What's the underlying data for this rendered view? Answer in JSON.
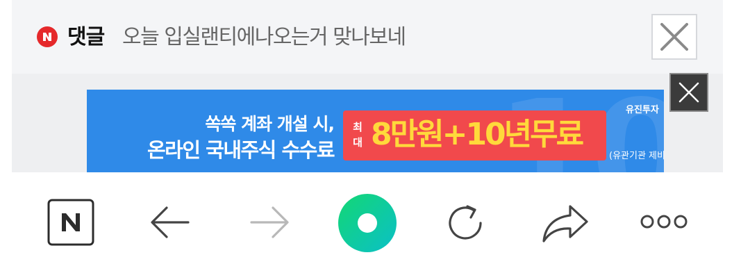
{
  "comment_bar": {
    "badge_letter": "N",
    "label": "댓글",
    "text": "오늘 입실랜티에나오는거 맞나보네",
    "close_icon": "close-icon"
  },
  "ad": {
    "line1": "쏙쏙 계좌 개설 시,",
    "line2": "온라인 국내주식 수수료",
    "prefix_line1": "최",
    "prefix_line2": "대",
    "offer": "8만원+10년무료",
    "brand": "유진투자",
    "disclaimer": "(유관기관 제비",
    "close_icon": "close-icon",
    "colors": {
      "background": "#2f8ae8",
      "promo": "#f1494c",
      "offer_text": "#ffd93b"
    }
  },
  "toolbar": {
    "items": [
      {
        "name": "naver-home",
        "icon": "naver-n-icon"
      },
      {
        "name": "back",
        "icon": "arrow-left-icon"
      },
      {
        "name": "forward",
        "icon": "arrow-right-icon",
        "disabled": true
      },
      {
        "name": "green-dot",
        "icon": "green-circle-icon"
      },
      {
        "name": "reload",
        "icon": "reload-icon"
      },
      {
        "name": "share",
        "icon": "share-arrow-icon"
      },
      {
        "name": "more",
        "icon": "more-dots-icon"
      }
    ],
    "naver_letter": "N"
  }
}
